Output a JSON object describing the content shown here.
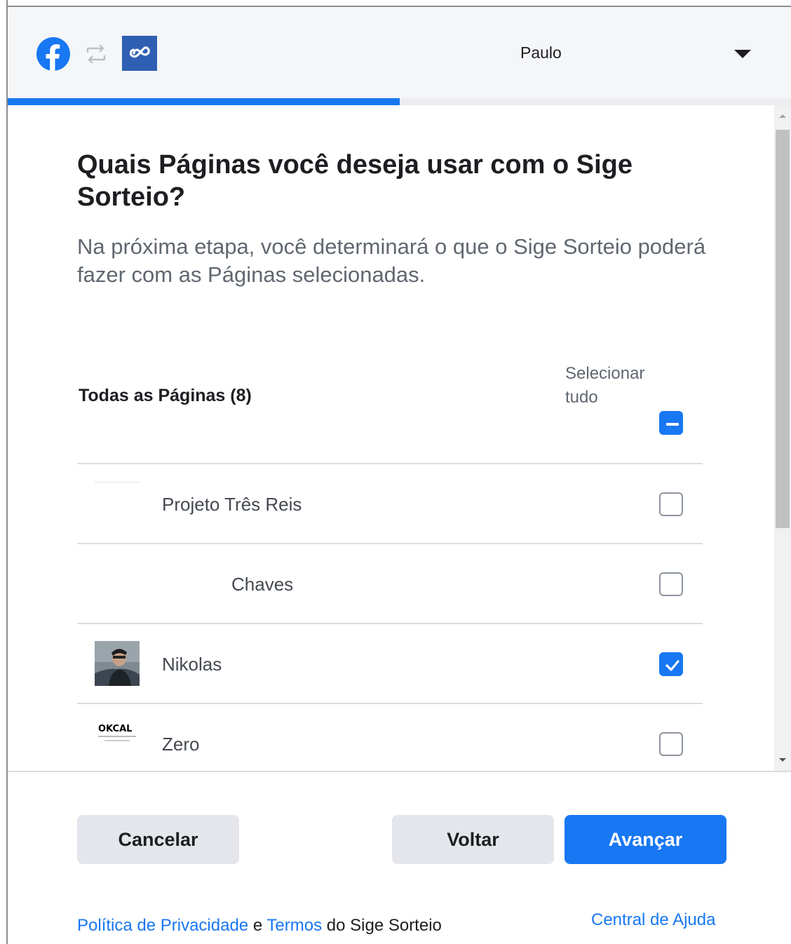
{
  "header": {
    "user_name": "Paulo",
    "progress_fraction": 0.5,
    "icons": [
      "facebook-icon",
      "swap-icon",
      "app-icon",
      "caret-down-icon"
    ]
  },
  "main": {
    "title": "Quais Páginas você deseja usar com o Sige Sorteio?",
    "subtitle": "Na próxima etapa, você determinará o que o Sige Sorteio poderá fazer com as Páginas selecionadas.",
    "all_pages_label": "Todas as Páginas (8)",
    "select_all_label": "Selecionar tudo",
    "select_all_state": "mixed",
    "pages": [
      {
        "name": "Projeto Três Reis",
        "checked": false
      },
      {
        "name": "Chaves",
        "checked": false
      },
      {
        "name": "Nikolas",
        "checked": true
      },
      {
        "name": "Zero",
        "checked": false,
        "logo_text": "OKCAL"
      }
    ]
  },
  "buttons": {
    "cancel": "Cancelar",
    "back": "Voltar",
    "next": "Avançar"
  },
  "footer": {
    "privacy": "Política de Privacidade",
    "and": "e",
    "terms": "Termos",
    "suffix": "do Sige Sorteio",
    "help": "Central de Ajuda"
  },
  "colors": {
    "accent": "#1877f2",
    "secondary_button": "#e4e6eb",
    "header_bg": "#f5f6f7"
  }
}
